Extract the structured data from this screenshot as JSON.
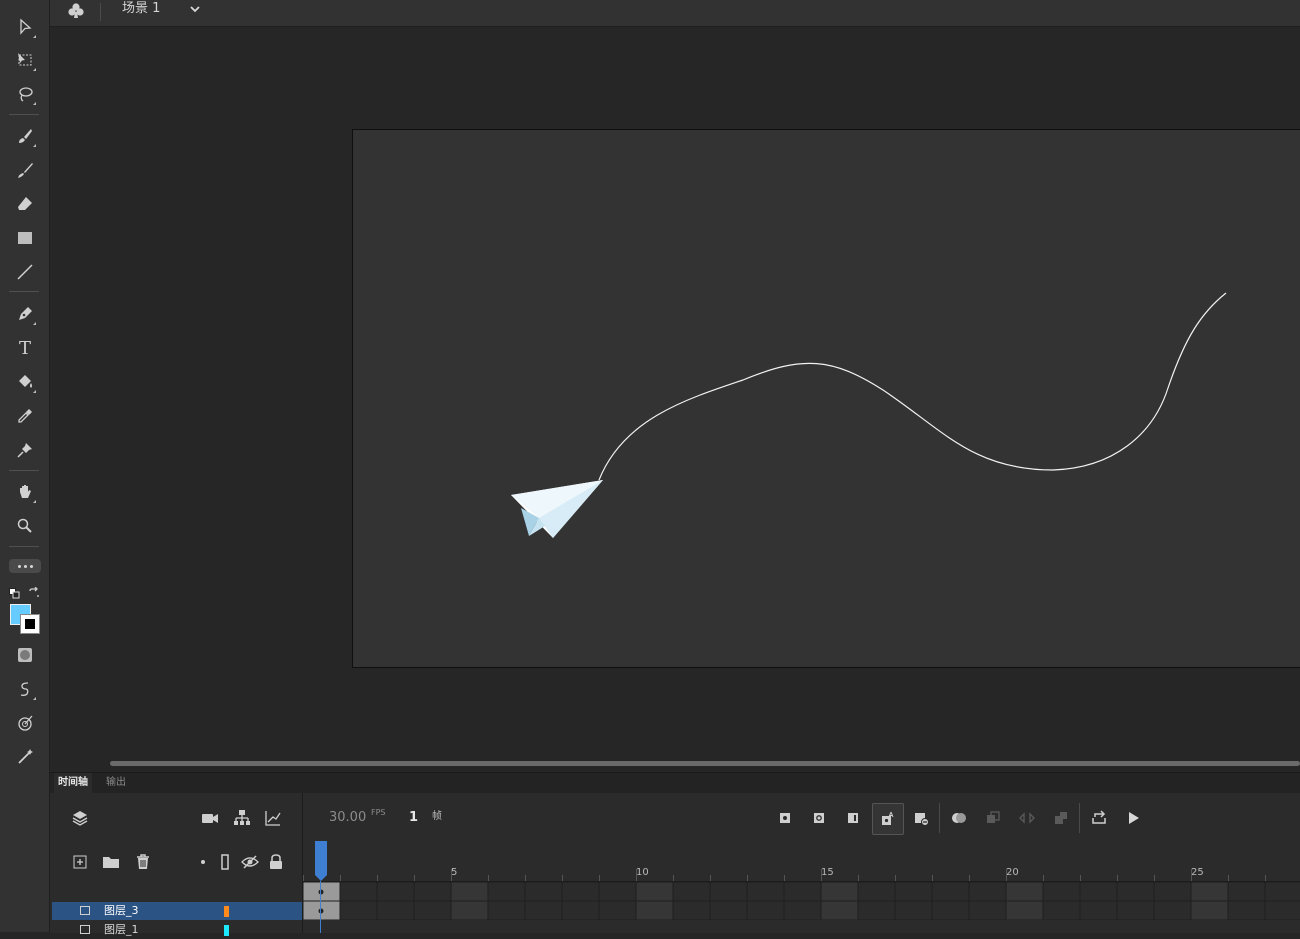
{
  "toolbar": {
    "tools": [
      {
        "name": "selection-tool",
        "icon": "arrow-icon"
      },
      {
        "name": "free-transform-tool",
        "icon": "transform-icon"
      },
      {
        "name": "lasso-tool",
        "icon": "lasso-icon"
      },
      {
        "name": "paint-brush-tool",
        "icon": "paint-brush-icon"
      },
      {
        "name": "brush-tool",
        "icon": "brush-icon"
      },
      {
        "name": "eraser-tool",
        "icon": "eraser-icon"
      },
      {
        "name": "rectangle-tool",
        "icon": "rectangle-icon"
      },
      {
        "name": "line-tool",
        "icon": "line-icon"
      },
      {
        "name": "pen-tool",
        "icon": "pen-icon"
      },
      {
        "name": "text-tool",
        "icon": "text-icon"
      },
      {
        "name": "paint-bucket-tool",
        "icon": "bucket-icon"
      },
      {
        "name": "eyedropper-tool",
        "icon": "eyedropper-icon"
      },
      {
        "name": "pin-tool",
        "icon": "pin-icon"
      },
      {
        "name": "hand-tool",
        "icon": "hand-icon"
      },
      {
        "name": "zoom-tool",
        "icon": "zoom-icon"
      }
    ],
    "text_tool_glyph": "T",
    "fill_color": "#66ccff",
    "stroke_color": "#000000"
  },
  "topbar": {
    "scene_name": "场景 1"
  },
  "timeline": {
    "tabs": [
      {
        "label": "时间轴",
        "active": true
      },
      {
        "label": "输出",
        "active": false
      }
    ],
    "fps": "30.00",
    "fps_unit": "FPS",
    "current_frame": "1",
    "frame_unit": "帧",
    "ruler_labels": [
      "5",
      "10",
      "15",
      "20",
      "25"
    ],
    "layers": [
      {
        "name": "图层_3",
        "color": "#ff8a1c",
        "selected": true
      },
      {
        "name": "图层_1",
        "color": "#1ce8ff",
        "selected": false
      }
    ]
  },
  "colors": {
    "accent": "#3f7fd1",
    "selection": "#2b5384"
  }
}
